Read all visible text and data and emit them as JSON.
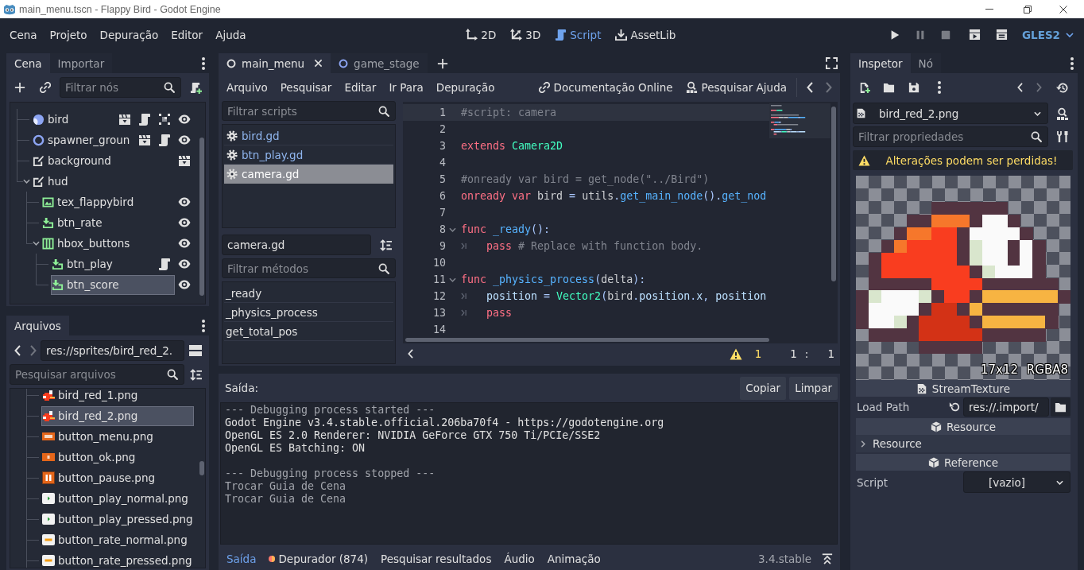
{
  "window": {
    "title": "main_menu.tscn - Flappy Bird - Godot Engine"
  },
  "menu_bar": {
    "menus": [
      "Cena",
      "Projeto",
      "Depuração",
      "Editor",
      "Ajuda"
    ],
    "workspaces": [
      {
        "label": "2D",
        "kind": "canvas",
        "selected": false
      },
      {
        "label": "3D",
        "kind": "spatial",
        "selected": false
      },
      {
        "label": "Script",
        "kind": "script",
        "selected": true
      },
      {
        "label": "AssetLib",
        "kind": "assetlib",
        "selected": false
      }
    ],
    "renderer": "GLES2"
  },
  "scene_dock": {
    "tabs": [
      {
        "label": "Cena",
        "selected": true
      },
      {
        "label": "Importar",
        "selected": false
      }
    ],
    "filter": {
      "placeholder": "Filtrar nós"
    },
    "tree": [
      {
        "name": "bird",
        "kind": "instance",
        "badges": [
          {
            "kind": "scene"
          },
          {
            "kind": "script"
          },
          {
            "kind": "group"
          },
          {
            "kind": "eye"
          }
        ],
        "selected": false
      },
      {
        "name": "spawner_groun",
        "kind": "node2d",
        "badges": [
          {
            "kind": "scene"
          },
          {
            "kind": "script"
          },
          {
            "kind": "eye"
          }
        ],
        "selected": false
      },
      {
        "name": "background",
        "kind": "canvas_layer",
        "badges": [
          {
            "kind": "scene"
          }
        ],
        "selected": false
      },
      {
        "name": "hud",
        "kind": "canvas_layer",
        "expanded": true,
        "selected": false,
        "children": [
          {
            "name": "tex_flappybird",
            "kind": "texture_rect",
            "badges": [
              {
                "kind": "eye"
              }
            ],
            "selected": false
          },
          {
            "name": "btn_rate",
            "kind": "texture_button",
            "badges": [
              {
                "kind": "eye"
              }
            ],
            "selected": false
          },
          {
            "name": "hbox_buttons",
            "kind": "hbox",
            "badges": [
              {
                "kind": "eye"
              }
            ],
            "expanded": true,
            "selected": false,
            "children": [
              {
                "name": "btn_play",
                "kind": "texture_button",
                "badges": [
                  {
                    "kind": "script"
                  },
                  {
                    "kind": "eye"
                  }
                ],
                "selected": false
              },
              {
                "name": "btn_score",
                "kind": "texture_button",
                "badges": [
                  {
                    "kind": "eye"
                  }
                ],
                "selected": true
              }
            ]
          }
        ]
      }
    ]
  },
  "file_dock": {
    "tabs": [
      {
        "label": "Arquivos",
        "selected": true
      }
    ],
    "path": "res://sprites/bird_red_2.",
    "search": {
      "placeholder": "Pesquisar arquivos"
    },
    "files": [
      {
        "name": "bird_red_1.png",
        "kind": "bird",
        "selected": false
      },
      {
        "name": "bird_red_2.png",
        "kind": "bird",
        "selected": true
      },
      {
        "name": "button_menu.png",
        "kind": "menu",
        "selected": false
      },
      {
        "name": "button_ok.png",
        "kind": "ok",
        "selected": false
      },
      {
        "name": "button_pause.png",
        "kind": "pause",
        "selected": false
      },
      {
        "name": "button_play_normal.png",
        "kind": "play",
        "selected": false
      },
      {
        "name": "button_play_pressed.png",
        "kind": "play",
        "selected": false
      },
      {
        "name": "button_rate_normal.png",
        "kind": "rate",
        "selected": false
      },
      {
        "name": "button_rate_pressed.png",
        "kind": "rate",
        "selected": false
      }
    ]
  },
  "script_editor": {
    "tabs": [
      {
        "label": "main_menu",
        "kind": "node",
        "selected": true
      },
      {
        "label": "game_stage",
        "kind": "node2d",
        "selected": false
      }
    ],
    "menus": [
      "Arquivo",
      "Pesquisar",
      "Editar",
      "Ir Para",
      "Depuração"
    ],
    "help_links": [
      {
        "label": "Documentação Online",
        "kind": "docs"
      },
      {
        "label": "Pesquisar Ajuda",
        "kind": "search_help"
      }
    ],
    "script_filter": {
      "placeholder": "Filtrar scripts"
    },
    "scripts": [
      {
        "name": "bird.gd",
        "highlighted": true,
        "selected": false
      },
      {
        "name": "btn_play.gd",
        "highlighted": true,
        "selected": false
      },
      {
        "name": "camera.gd",
        "highlighted": false,
        "selected": true
      }
    ],
    "current_script": "camera.gd",
    "method_filter": {
      "placeholder": "Filtrar métodos"
    },
    "methods": [
      {
        "name": "_ready",
        "selected": false
      },
      {
        "name": "_physics_process",
        "selected": false
      },
      {
        "name": "get_total_pos",
        "selected": false
      }
    ],
    "code": [
      {
        "number": "1",
        "selected": true,
        "tokens": [
          {
            "text": "#script: camera",
            "kind": "comment"
          }
        ]
      },
      {
        "number": "2",
        "selected": false
      },
      {
        "number": "3",
        "selected": false,
        "tokens": [
          {
            "text": "extends ",
            "kind": "keyword"
          },
          {
            "text": "Camera2D",
            "kind": "type"
          }
        ]
      },
      {
        "number": "4",
        "selected": false
      },
      {
        "number": "5",
        "selected": false,
        "tokens": [
          {
            "text": "#onready var bird = get_node(\"../Bird\")",
            "kind": "comment"
          }
        ]
      },
      {
        "number": "6",
        "selected": false,
        "tokens": [
          {
            "text": "onready var",
            "kind": "keyword"
          },
          {
            "text": " bird ",
            "kind": "plain"
          },
          {
            "text": "=",
            "kind": "symbol"
          },
          {
            "text": " utils",
            "kind": "plain"
          },
          {
            "text": ".",
            "kind": "symbol"
          },
          {
            "text": "get_main_node",
            "kind": "function"
          },
          {
            "text": "()",
            "kind": "symbol"
          },
          {
            "text": ".",
            "kind": "symbol"
          },
          {
            "text": "get_nod",
            "kind": "function"
          }
        ]
      },
      {
        "number": "7",
        "selected": false
      },
      {
        "number": "8",
        "selected": false,
        "expanded": true,
        "tokens": [
          {
            "text": "func ",
            "kind": "keyword"
          },
          {
            "text": "_ready",
            "kind": "function"
          },
          {
            "text": "():",
            "kind": "symbol"
          }
        ]
      },
      {
        "number": "9",
        "selected": false,
        "tokens": [
          {
            "kind": "tab"
          },
          {
            "text": "pass ",
            "kind": "keyword"
          },
          {
            "text": "# Replace with function body.",
            "kind": "comment"
          }
        ]
      },
      {
        "number": "10",
        "selected": false
      },
      {
        "number": "11",
        "selected": false,
        "expanded": true,
        "tokens": [
          {
            "text": "func ",
            "kind": "keyword"
          },
          {
            "text": "_physics_process",
            "kind": "function"
          },
          {
            "text": "(",
            "kind": "symbol"
          },
          {
            "text": "delta",
            "kind": "plain"
          },
          {
            "text": "):",
            "kind": "symbol"
          }
        ]
      },
      {
        "number": "12",
        "selected": false,
        "tokens": [
          {
            "kind": "tab"
          },
          {
            "text": "position ",
            "kind": "member"
          },
          {
            "text": "= ",
            "kind": "symbol"
          },
          {
            "text": "Vector2",
            "kind": "type"
          },
          {
            "text": "(",
            "kind": "symbol"
          },
          {
            "text": "bird",
            "kind": "plain"
          },
          {
            "text": ".",
            "kind": "symbol"
          },
          {
            "text": "position",
            "kind": "member"
          },
          {
            "text": ".",
            "kind": "symbol"
          },
          {
            "text": "x",
            "kind": "member"
          },
          {
            "text": ", ",
            "kind": "symbol"
          },
          {
            "text": "position",
            "kind": "member"
          }
        ]
      },
      {
        "number": "13",
        "selected": false,
        "tokens": [
          {
            "kind": "tab"
          },
          {
            "text": "pass",
            "kind": "keyword"
          }
        ]
      },
      {
        "number": "14",
        "selected": false
      }
    ],
    "status": {
      "warnings": "1",
      "cursor": {
        "line": "1",
        "separator": ":",
        "column": "1"
      }
    }
  },
  "output": {
    "title": "Saída:",
    "buttons": [
      "Copiar",
      "Limpar"
    ],
    "log": [
      {
        "text": "--- Debugging process started ---",
        "kind": "editor"
      },
      {
        "text": "Godot Engine v3.4.stable.official.206ba70f4 - https://godotengine.org",
        "kind": "stdout"
      },
      {
        "text": "OpenGL ES 2.0 Renderer: NVIDIA GeForce GTX 750 Ti/PCIe/SSE2",
        "kind": "stdout"
      },
      {
        "text": "OpenGL ES Batching: ON",
        "kind": "stdout"
      },
      {
        "kind": "blank"
      },
      {
        "text": "--- Debugging process stopped ---",
        "kind": "editor"
      },
      {
        "text": "Trocar Guia de Cena",
        "kind": "editor"
      },
      {
        "text": "Trocar Guia de Cena",
        "kind": "editor"
      }
    ],
    "tabs": [
      {
        "label": "Saída",
        "selected": true,
        "alert": false
      },
      {
        "label": "Depurador (874)",
        "selected": false,
        "alert": true
      },
      {
        "label": "Pesquisar resultados",
        "selected": false,
        "alert": false
      },
      {
        "label": "Áudio",
        "selected": false,
        "alert": false
      },
      {
        "label": "Animação",
        "selected": false,
        "alert": false
      }
    ],
    "version": "3.4.stable"
  },
  "inspector": {
    "tabs": [
      {
        "label": "Inspetor",
        "selected": true
      },
      {
        "label": "Nó",
        "selected": false
      }
    ],
    "resource": "bird_red_2.png",
    "filter": {
      "placeholder": "Filtrar propriedades"
    },
    "warning": "Alterações podem ser perdidas!",
    "preview": {
      "info": "17x12 RGBA8"
    },
    "properties": [
      {
        "kind": "texture_category",
        "label": "StreamTexture"
      },
      {
        "kind": "path_property",
        "label": "Load Path",
        "value": "res://.import/"
      },
      {
        "kind": "object_category",
        "label": "Resource"
      },
      {
        "kind": "group",
        "label": "Resource",
        "expanded": false
      },
      {
        "kind": "object_category",
        "label": "Reference"
      },
      {
        "kind": "dropdown_property",
        "label": "Script",
        "value": "[vazio]"
      }
    ]
  }
}
